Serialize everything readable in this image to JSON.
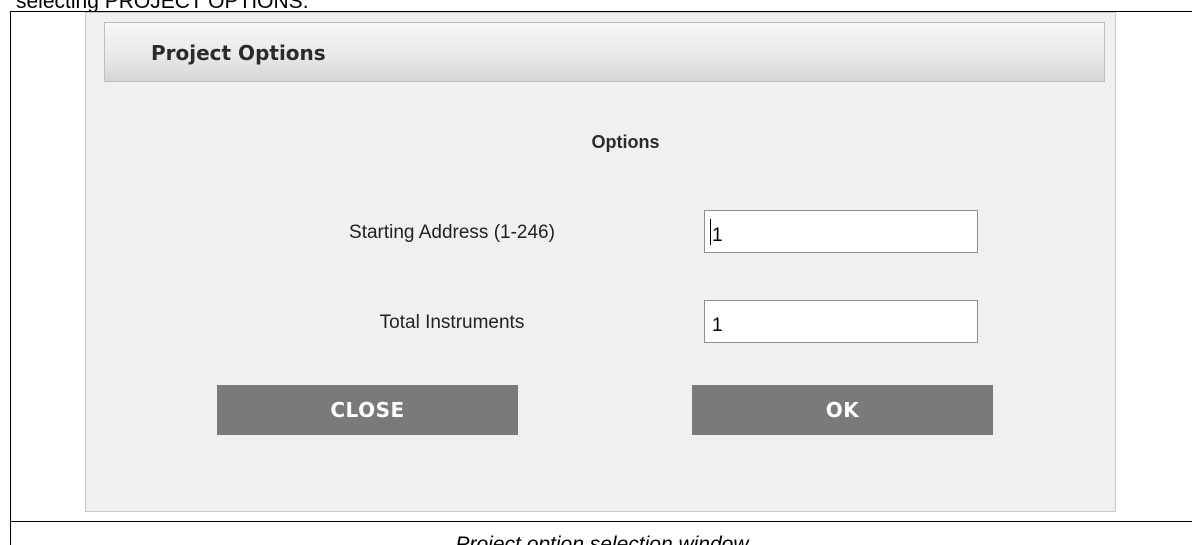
{
  "document": {
    "top_text": "selecting PROJECT OPTIONS.",
    "caption": "Project option selection window"
  },
  "dialog": {
    "title": "Project Options",
    "section_title": "Options",
    "fields": {
      "starting_address": {
        "label": "Starting Address (1-246)",
        "value": "1"
      },
      "total_instruments": {
        "label": "Total Instruments",
        "value": "1"
      }
    },
    "buttons": {
      "close_label": "CLOSE",
      "ok_label": "OK"
    }
  },
  "colors": {
    "dialog_background": "#f1f0f1",
    "button_background": "#7a7a7a",
    "button_text": "#ffffff"
  }
}
